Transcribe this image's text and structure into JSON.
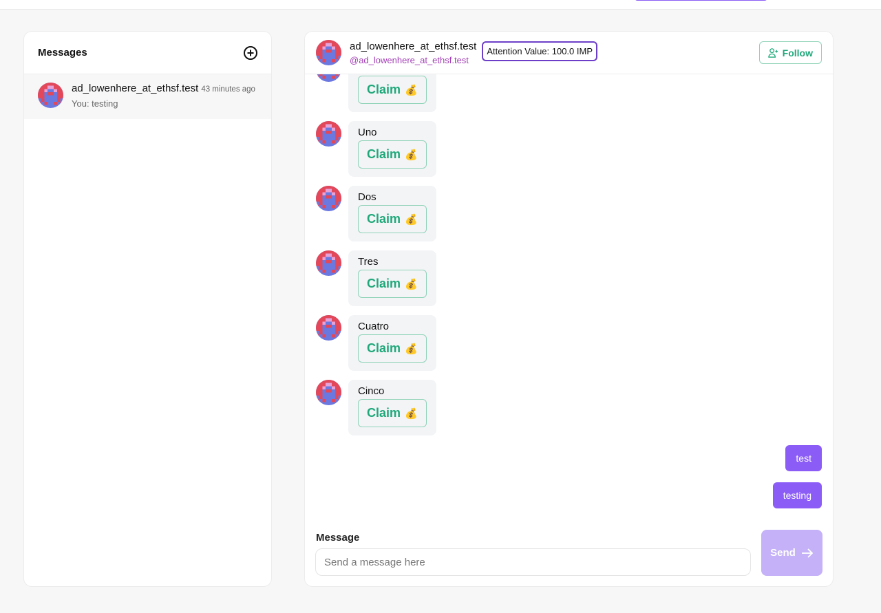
{
  "sidebar": {
    "title": "Messages",
    "new_icon": "plus-circle-icon",
    "conversations": [
      {
        "name": "ad_lowenhere_at_ethsf.test",
        "time": "43 minutes ago",
        "preview": "You: testing"
      }
    ]
  },
  "chat": {
    "name": "ad_lowenhere_at_ethsf.test",
    "handle": "@ad_lowenhere_at_ethsf.test",
    "attention": "Attention Value: 100.0 IMP",
    "follow_label": "Follow",
    "claim_label": "Claim",
    "claim_emoji": "💰",
    "received": [
      {
        "text": ""
      },
      {
        "text": "Uno"
      },
      {
        "text": "Dos"
      },
      {
        "text": "Tres"
      },
      {
        "text": "Cuatro"
      },
      {
        "text": "Cinco"
      }
    ],
    "sent": [
      {
        "text": "test"
      },
      {
        "text": "testing"
      }
    ],
    "composer": {
      "label": "Message",
      "placeholder": "Send a message here",
      "value": "",
      "send_label": "Send"
    }
  },
  "colors": {
    "accent": "#8b5cf6",
    "claim_green": "#1fa87a",
    "handle": "#a33fb6",
    "attention_border": "#6d3fc8"
  }
}
